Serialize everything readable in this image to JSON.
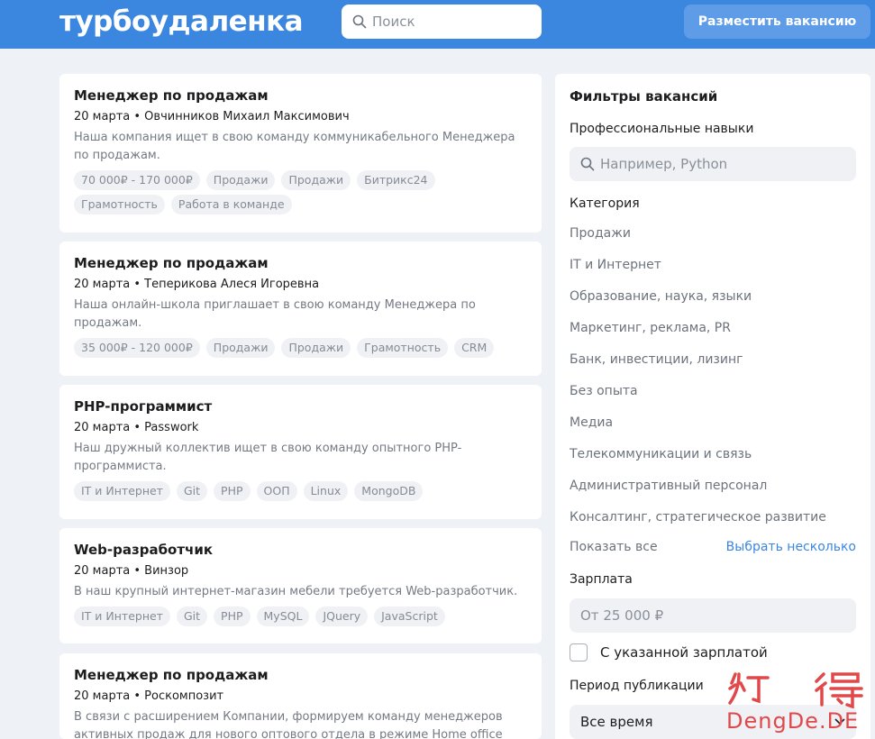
{
  "header": {
    "logo": "турбоудаленка",
    "search_placeholder": "Поиск",
    "post_button": "Разместить вакансию"
  },
  "vacancies": [
    {
      "title": "Менеджер по продажам",
      "meta": "20 марта • Овчинников Михаил Максимович",
      "description": "Наша компания ищет в свою команду коммуникабельного Менеджера по продажам.",
      "tags": [
        "70 000₽ - 170 000₽",
        "Продажи",
        "Продажи",
        "Битрикс24",
        "Грамотность",
        "Работа в команде"
      ]
    },
    {
      "title": "Менеджер по продажам",
      "meta": "20 марта • Теперикова Алеся Игоревна",
      "description": "Наша онлайн-школа приглашает в свою команду Менеджера по продажам.",
      "tags": [
        "35 000₽ - 120 000₽",
        "Продажи",
        "Продажи",
        "Грамотность",
        "CRM"
      ]
    },
    {
      "title": "PHP-программист",
      "meta": "20 марта • Passwork",
      "description": "Наш дружный коллектив ищет в свою команду опытного PHP-программиста.",
      "tags": [
        "IT и Интернет",
        "Git",
        "PHP",
        "ООП",
        "Linux",
        "MongoDB"
      ]
    },
    {
      "title": "Web-разработчик",
      "meta": "20 марта • Винзор",
      "description": "В наш крупный интернет-магазин мебели требуется Web-разработчик.",
      "tags": [
        "IT и Интернет",
        "Git",
        "PHP",
        "MySQL",
        "JQuery",
        "JavaScript"
      ]
    },
    {
      "title": "Менеджер по продажам",
      "meta": "20 марта • Роскомпозит",
      "description": "В связи с расширением Компании, формируем команду менеджеров активных продаж для нового оптового отдела в режиме Home office",
      "tags": []
    }
  ],
  "filters": {
    "title": "Фильтры вакансий",
    "skills_label": "Профессиональные навыки",
    "skills_placeholder": "Например, Python",
    "category_label": "Категория",
    "categories": [
      "Продажи",
      "IT и Интернет",
      "Образование, наука, языки",
      "Маркетинг, реклама, PR",
      "Банк, инвестиции, лизинг",
      "Без опыта",
      "Медиа",
      "Телекоммуникации и связь",
      "Административный персонал",
      "Консалтинг, стратегическое развитие"
    ],
    "show_all": "Показать все",
    "select_multiple": "Выбрать несколько",
    "salary_label": "Зарплата",
    "salary_placeholder": "От 25 000 ₽",
    "salary_checkbox_label": "С указанной зарплатой",
    "period_label": "Период публикации",
    "period_value": "Все время"
  },
  "watermark": "DengDe.DE"
}
